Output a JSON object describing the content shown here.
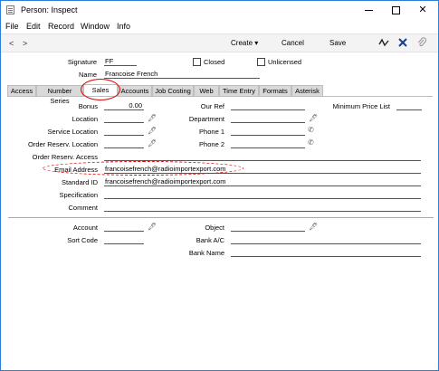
{
  "window": {
    "title": "Person: Inspect"
  },
  "menu": [
    "File",
    "Edit",
    "Record",
    "Window",
    "Info"
  ],
  "toolbar": {
    "prev": "<",
    "next": ">",
    "create": "Create",
    "cancel": "Cancel",
    "save": "Save"
  },
  "icons": {
    "tool1": "activity-icon",
    "tool2": "connect-icon",
    "tool3": "attachment-icon"
  },
  "header": {
    "signature_label": "Signature",
    "signature_value": "FF",
    "name_label": "Name",
    "name_value": "Francoise French",
    "closed_label": "Closed",
    "unlicensed_label": "Unlicensed"
  },
  "tabs": [
    "Access",
    "Number Series",
    "Sales",
    "Accounts",
    "Job Costing",
    "Web",
    "Time Entry",
    "Formats",
    "Asterisk"
  ],
  "active_tab": "Sales",
  "form": {
    "bonus_label": "Bonus",
    "bonus_value": "0.00",
    "our_ref_label": "Our Ref",
    "our_ref_value": "",
    "min_price_list_label": "Minimum Price List",
    "min_price_list_value": "",
    "location_label": "Location",
    "location_value": "",
    "department_label": "Department",
    "department_value": "",
    "service_location_label": "Service Location",
    "service_location_value": "",
    "phone1_label": "Phone 1",
    "phone1_value": "",
    "order_reserv_location_label": "Order Reserv. Location",
    "order_reserv_location_value": "",
    "phone2_label": "Phone 2",
    "phone2_value": "",
    "order_reserv_access_label": "Order Reserv. Access",
    "order_reserv_access_value": "",
    "email_label": "Email Address",
    "email_value": "francoisefrench@radioimportexport.com",
    "standard_id_label": "Standard ID",
    "standard_id_value": "francoisefrench@radioimportexport.com",
    "specification_label": "Specification",
    "specification_value": "",
    "comment_label": "Comment",
    "comment_value": "",
    "account_label": "Account",
    "account_value": "",
    "object_label": "Object",
    "object_value": "",
    "sort_code_label": "Sort Code",
    "sort_code_value": "",
    "bank_ac_label": "Bank A/C",
    "bank_ac_value": "",
    "bank_name_label": "Bank Name",
    "bank_name_value": ""
  },
  "colors": {
    "highlight": "#e00000",
    "window_border": "#2b7fd8"
  }
}
